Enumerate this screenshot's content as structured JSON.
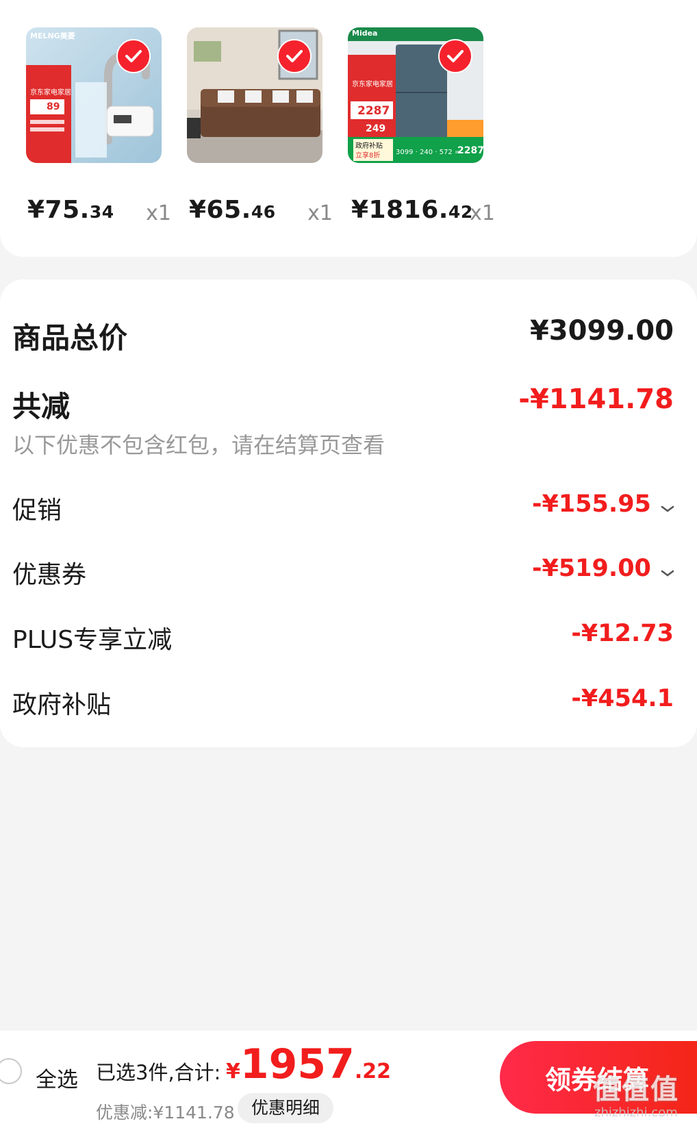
{
  "products": [
    {
      "name": "faucet-heater",
      "price_int": "¥75.",
      "price_dec": "34",
      "qty": "x1"
    },
    {
      "name": "storage-bench",
      "price_int": "¥65.",
      "price_dec": "46",
      "qty": "x1"
    },
    {
      "name": "refrigerator",
      "price_int": "¥1816.",
      "price_dec": "42",
      "qty": "x1"
    }
  ],
  "product_labels": {
    "p1_brand": "MELNG美菱",
    "p1_tag": "京东家电家居",
    "p1_price": "89",
    "p3_brand": "Midea",
    "p3_tag": "京东家电家居",
    "p3_price": "2287",
    "p3_sub": "249",
    "p3_gov": "政府补贴",
    "p3_gov2": "立享8折",
    "p3_calc": "3099 · 240 · 572 =",
    "p3_final": "2287"
  },
  "summary": {
    "total_label": "商品总价",
    "total_value": "¥3099.00",
    "reduce_label": "共减",
    "reduce_value": "-¥1141.78",
    "note": "以下优惠不包含红包，请在结算页查看",
    "items": [
      {
        "label": "促销",
        "value": "-¥155.95",
        "expandable": true
      },
      {
        "label": "优惠券",
        "value": "-¥519.00",
        "expandable": true
      },
      {
        "label": "PLUS专享立减",
        "value": "-¥12.73",
        "expandable": false
      },
      {
        "label": "政府补贴",
        "value": "-¥454.1",
        "expandable": false
      }
    ]
  },
  "bottom": {
    "select_all": "全选",
    "selected_text": "已选3件,合计:",
    "currency": "¥",
    "total_int": "1957",
    "total_dec": ".22",
    "discount_text": "优惠减:¥1141.78",
    "detail_button": "优惠明细",
    "checkout_button": "领券结算",
    "watermark": "zhizhizhi.com",
    "watermark_glyphs": "值值值"
  },
  "colors": {
    "accent": "#f21d1d",
    "check": "#f5222d",
    "bg": "#f4f4f4"
  }
}
